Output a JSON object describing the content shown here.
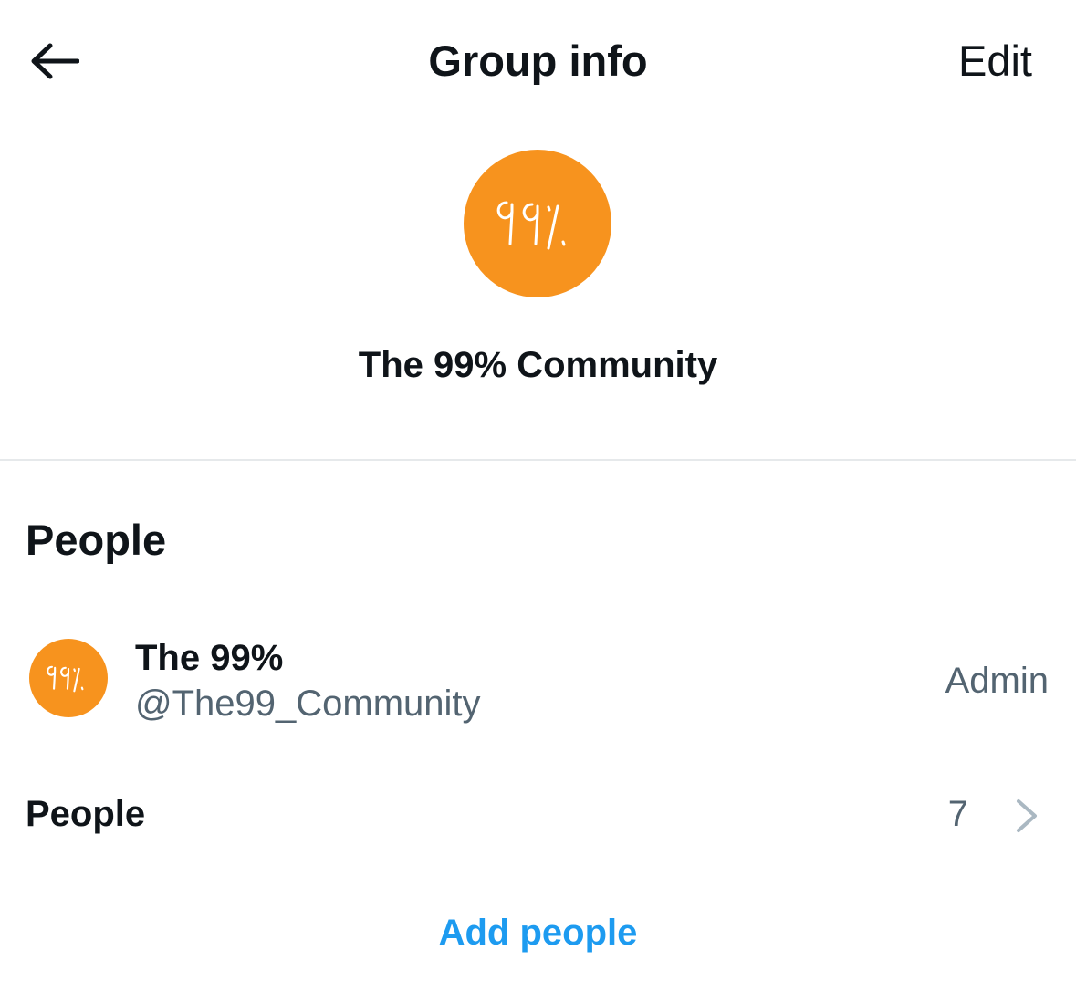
{
  "header": {
    "title": "Group info",
    "edit_label": "Edit",
    "back_icon": "arrow-left-icon"
  },
  "group": {
    "name": "The 99% Community",
    "avatar_text": "99%",
    "avatar_color": "#f7931e"
  },
  "people_section": {
    "heading": "People",
    "members": [
      {
        "name": "The 99%",
        "handle": "@The99_Community",
        "role": "Admin",
        "avatar_text": "99%"
      }
    ],
    "people_row": {
      "label": "People",
      "count": "7",
      "chevron_icon": "chevron-right-icon"
    },
    "add_people_label": "Add people"
  },
  "colors": {
    "primary_text": "#0f1419",
    "secondary_text": "#536471",
    "accent": "#1d9bf0",
    "avatar_orange": "#f7931e",
    "divider": "#e6e9eb",
    "chevron": "#aab8c2"
  }
}
